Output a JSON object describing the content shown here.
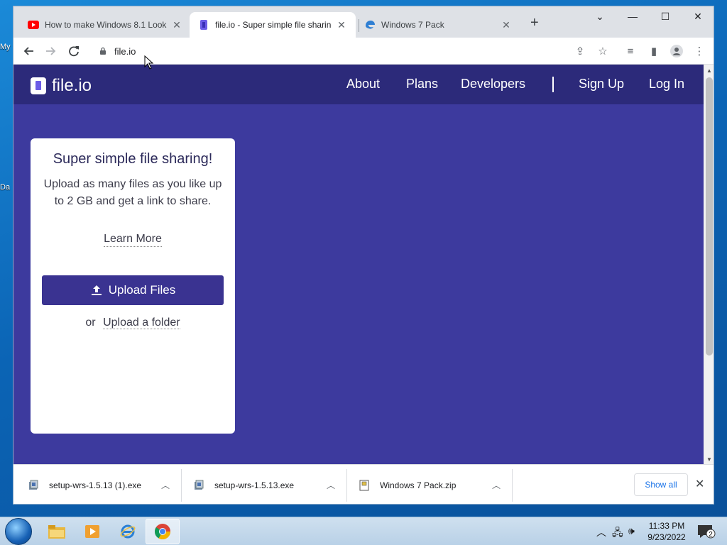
{
  "desktop": {
    "fragments": [
      "My",
      "Da"
    ]
  },
  "browser": {
    "tabs": [
      {
        "title": "How to make Windows 8.1 Look",
        "favicon": "youtube-icon"
      },
      {
        "title": "file.io - Super simple file sharing",
        "favicon": "fileio-icon"
      },
      {
        "title": "Windows 7 Pack",
        "favicon": "edge-icon"
      }
    ],
    "address": "file.io"
  },
  "site": {
    "logo_text": "file.io",
    "nav": {
      "about": "About",
      "plans": "Plans",
      "developers": "Developers",
      "signup": "Sign Up",
      "login": "Log In"
    },
    "card": {
      "title": "Super simple file sharing!",
      "description": "Upload as many files as you like up to 2 GB and get a link to share.",
      "learn_more": "Learn More",
      "upload_button": "Upload Files",
      "or": "or",
      "upload_folder": "Upload a folder"
    }
  },
  "downloads": {
    "items": [
      {
        "name": "setup-wrs-1.5.13 (1).exe"
      },
      {
        "name": "setup-wrs-1.5.13.exe"
      },
      {
        "name": "Windows 7 Pack.zip"
      }
    ],
    "show_all": "Show all"
  },
  "taskbar": {
    "time": "11:33 PM",
    "date": "9/23/2022",
    "notifications": "2"
  },
  "colors": {
    "page_bg": "#3d3a9e",
    "header_bg": "#2c2a7a",
    "button_bg": "#3a3391",
    "link_blue": "#1a73e8"
  }
}
